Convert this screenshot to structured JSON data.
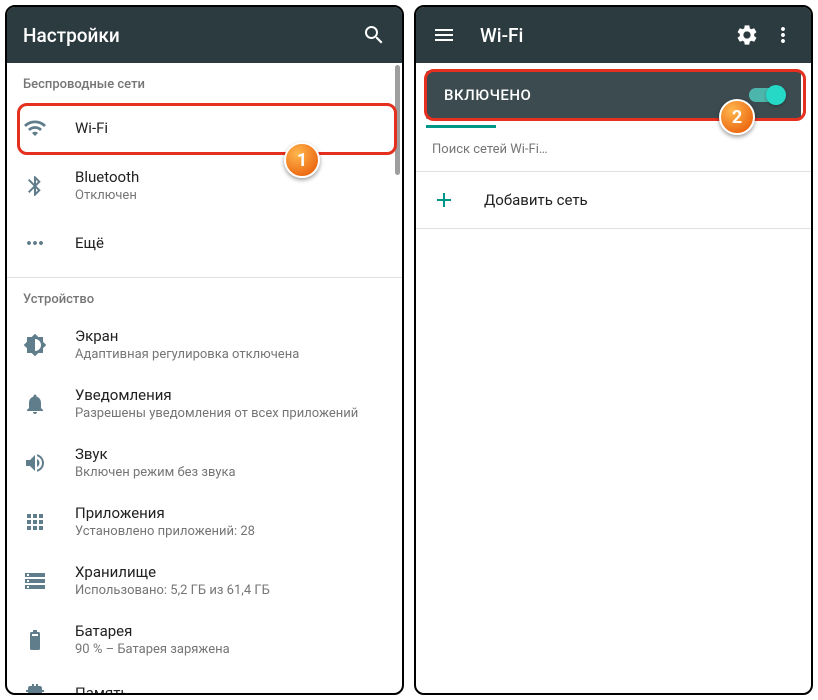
{
  "left": {
    "title": "Настройки",
    "sections": {
      "wireless": "Беспроводные сети",
      "device": "Устройство"
    },
    "items": {
      "wifi": {
        "title": "Wi-Fi"
      },
      "bluetooth": {
        "title": "Bluetooth",
        "sub": "Отключен"
      },
      "more": {
        "title": "Ещё"
      },
      "display": {
        "title": "Экран",
        "sub": "Адаптивная регулировка отключена"
      },
      "notifications": {
        "title": "Уведомления",
        "sub": "Разрешены уведомления от всех приложений"
      },
      "sound": {
        "title": "Звук",
        "sub": "Включен режим без звука"
      },
      "apps": {
        "title": "Приложения",
        "sub": "Установлено приложений: 28"
      },
      "storage": {
        "title": "Хранилище",
        "sub": "Использовано: 5,2 ГБ из 61,4 ГБ"
      },
      "battery": {
        "title": "Батарея",
        "sub": "90 % – Батарея заряжена"
      },
      "memory": {
        "title": "Память"
      }
    }
  },
  "right": {
    "title": "Wi-Fi",
    "toggle": "ВКЛЮЧЕНО",
    "searching": "Поиск сетей Wi-Fi…",
    "add": "Добавить сеть"
  },
  "callouts": {
    "one": "1",
    "two": "2"
  }
}
